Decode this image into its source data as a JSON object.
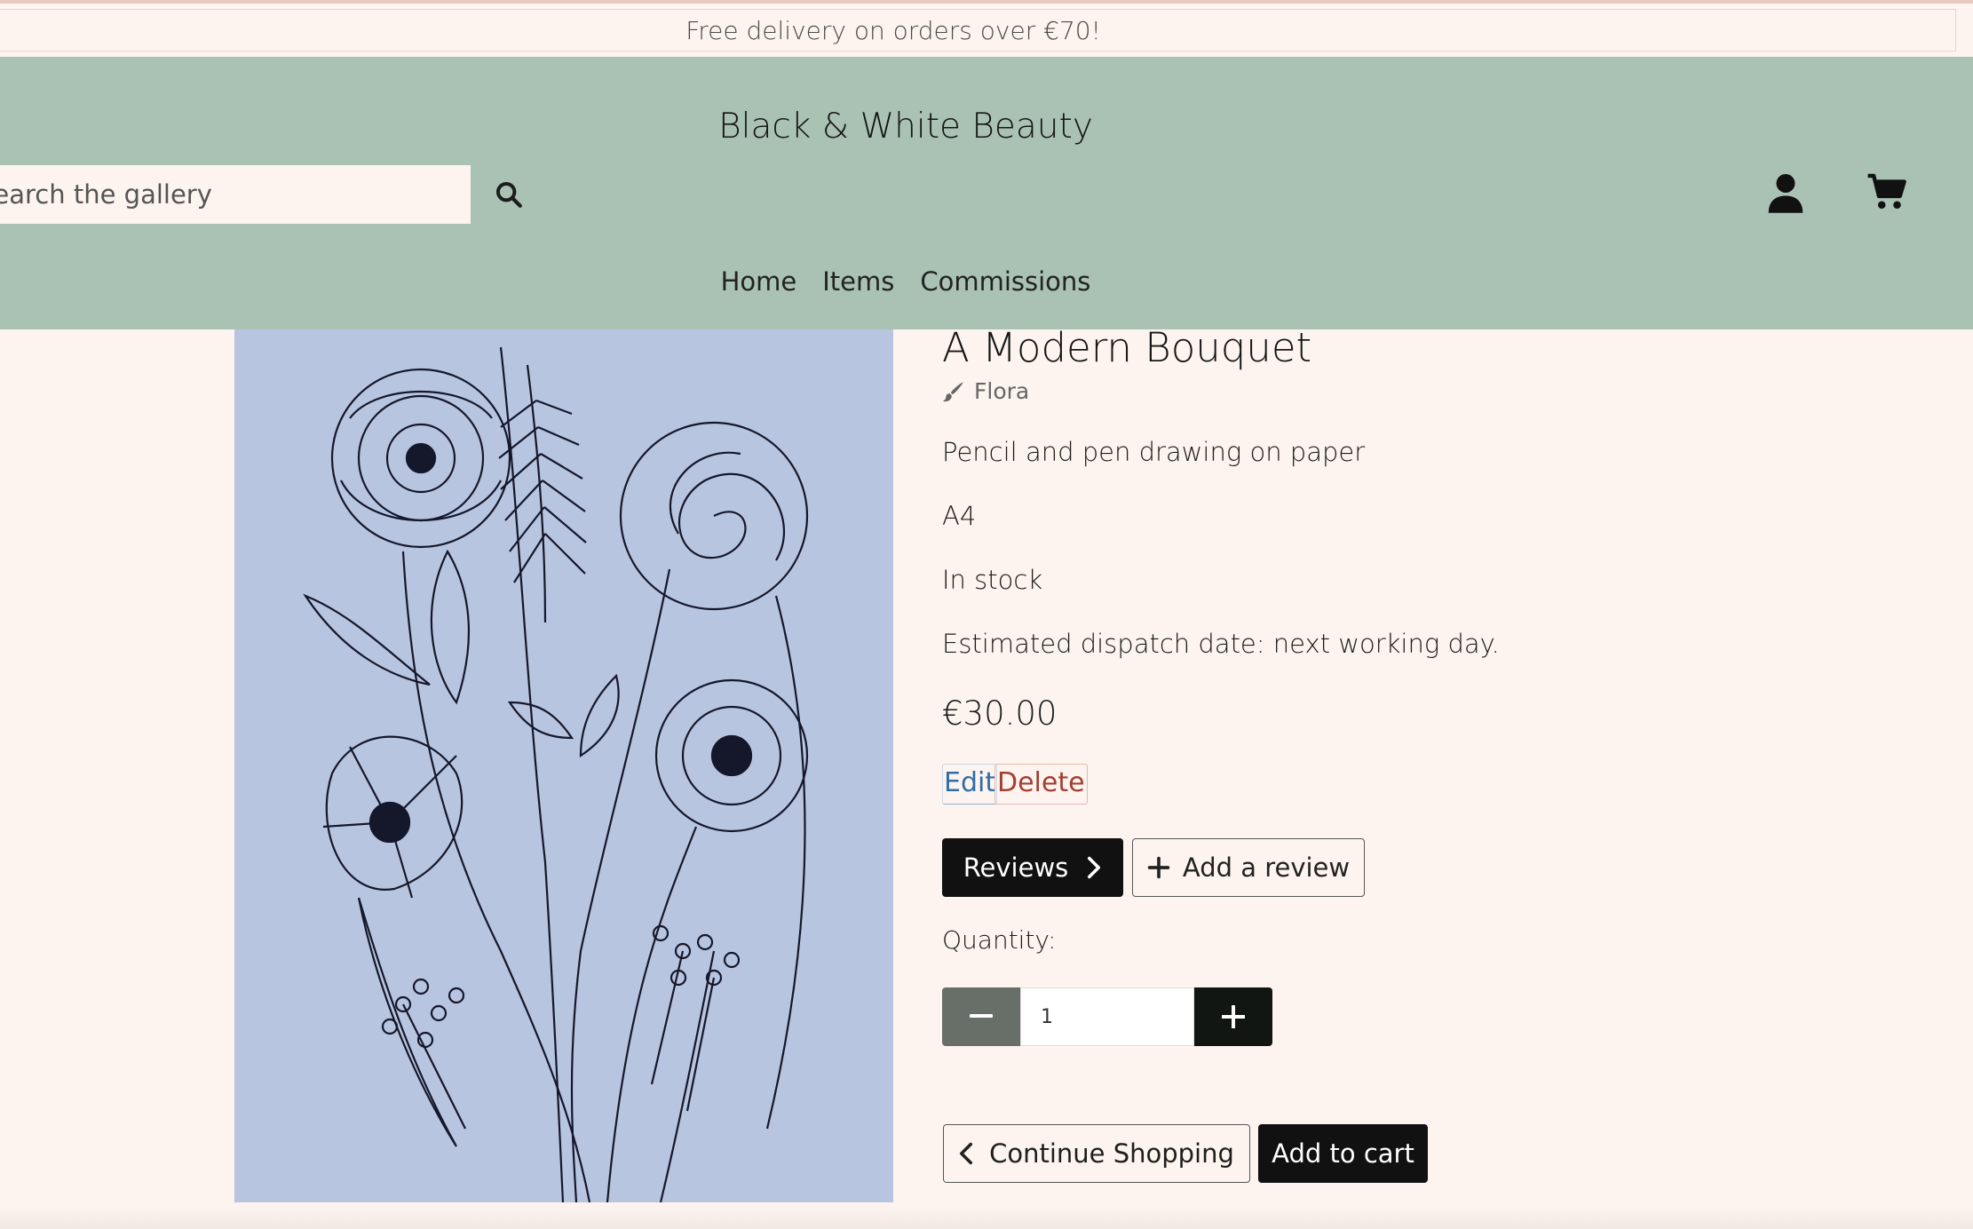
{
  "banner": {
    "text": "Free delivery on orders over €70!"
  },
  "header": {
    "brand": "Black & White Beauty",
    "search": {
      "placeholder": "Search the gallery"
    },
    "nav": [
      "Home",
      "Items",
      "Commissions"
    ]
  },
  "product": {
    "title": "A Modern Bouquet",
    "category": "Flora",
    "medium": "Pencil and pen drawing on paper",
    "size": "A4",
    "stock": "In stock",
    "dispatch": "Estimated dispatch date: next working day.",
    "price": "€30.00",
    "admin": {
      "edit": "Edit",
      "delete": "Delete"
    },
    "reviews_button": "Reviews",
    "add_review_button": "Add a review",
    "quantity_label": "Quantity:",
    "quantity": "1",
    "continue_button": "Continue Shopping",
    "add_to_cart_button": "Add to cart"
  },
  "colors": {
    "background": "#fdf4ef",
    "header": "#a9c2b4",
    "button_dark": "#111111",
    "edit": "#2e6ea8",
    "delete": "#a43f32"
  }
}
